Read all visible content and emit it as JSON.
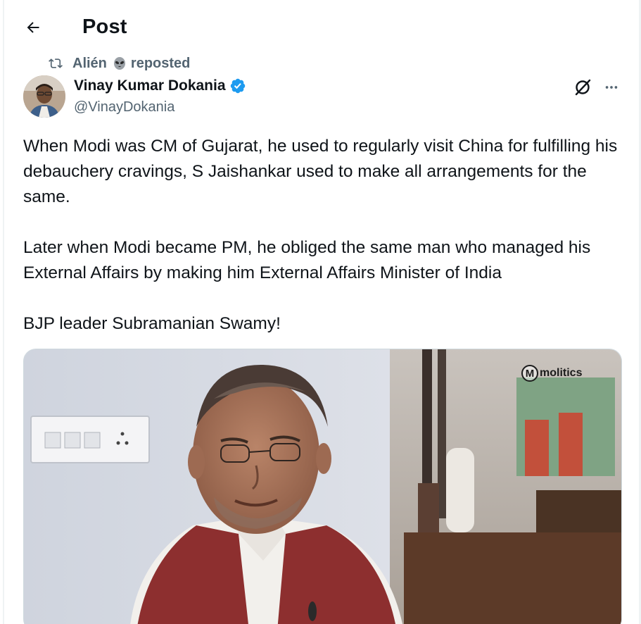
{
  "header": {
    "title": "Post",
    "back_icon": "arrow-left-icon"
  },
  "repost": {
    "icon": "repost-icon",
    "reposter": "Alién",
    "emoji": "alien-icon",
    "label": "reposted"
  },
  "author": {
    "name": "Vinay Kumar Dokania",
    "handle": "@VinayDokania",
    "verified": true,
    "verified_color": "#1d9bf0"
  },
  "actions": {
    "grok_icon": "grok-icon",
    "more_icon": "more-horizontal-icon"
  },
  "post": {
    "paragraph_1": "When Modi was CM of Gujarat, he used to regularly visit China for fulfilling his debauchery cravings, S Jaishankar used to make all arrangements for the same.",
    "paragraph_2": "Later when Modi became PM, he obliged the same man who managed his External Affairs by making him External Affairs Minister of India",
    "paragraph_3": "BJP leader Subramanian Swamy!"
  },
  "media": {
    "watermark_letter": "M",
    "watermark_text": "molitics"
  },
  "colors": {
    "text": "#0f1419",
    "secondary": "#536471",
    "accent": "#1d9bf0"
  }
}
